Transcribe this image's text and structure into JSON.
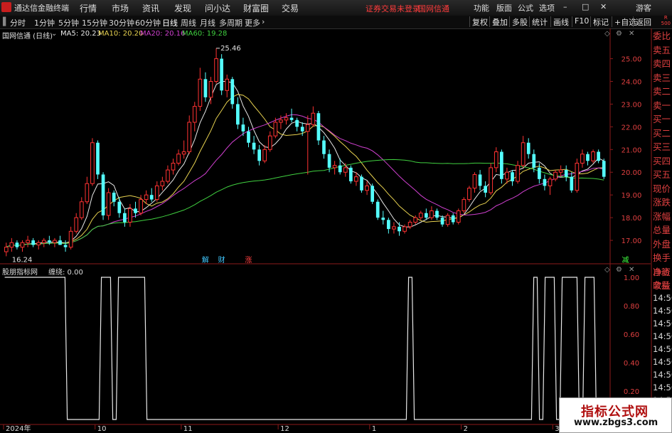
{
  "app_title": "通达信金融终端",
  "menu": [
    "行情",
    "市场",
    "资讯",
    "发现",
    "问小达",
    "财富圈",
    "交易"
  ],
  "notice": [
    "证券交易未登录",
    "国网信通"
  ],
  "right_menu": [
    "功能",
    "版面",
    "公式",
    "选项"
  ],
  "user": "游客",
  "timeframes": [
    "分时",
    "1分钟",
    "5分钟",
    "15分钟",
    "30分钟",
    "60分钟",
    "日线",
    "周线",
    "月线",
    "多周期",
    "更多"
  ],
  "active_timeframe": "日线",
  "right_buttons": [
    "复权",
    "叠加",
    "多股",
    "统计",
    "画线",
    "F10",
    "标记",
    "+自选",
    "返回"
  ],
  "r_badge": [
    "R",
    "500"
  ],
  "stock_label": "国网信通 (日线)",
  "ma": [
    {
      "label": "MA5: 20.23",
      "color": "#e8e8e8"
    },
    {
      "label": "MA10: 20.20",
      "color": "#e8d250"
    },
    {
      "label": "MA20: 20.16",
      "color": "#d040d0"
    },
    {
      "label": "MA60: 19.28",
      "color": "#40d040"
    }
  ],
  "order_panel": [
    "委比",
    "卖五",
    "卖四",
    "卖三",
    "卖二",
    "卖一",
    "买一",
    "买二",
    "买三",
    "买四",
    "买五",
    "现价",
    "涨跌",
    "涨幅",
    "总量",
    "外盘",
    "换手",
    "净资",
    "收益"
  ],
  "low_panel": [
    "自动",
    "交易",
    "14:56",
    "14:56",
    "14:56",
    "14:56",
    "14:56",
    "14:56",
    "14:56",
    "14:56",
    "14:56"
  ],
  "indicator_label": "股朋指标网",
  "indicator_value": "缠绕: 0.00",
  "markers": [
    {
      "text": "解",
      "color": "#40c8ff"
    },
    {
      "text": "财",
      "color": "#40c8ff"
    },
    {
      "text": "涨",
      "color": "#ff4040"
    },
    {
      "text": "减",
      "color": "#40ff40"
    }
  ],
  "watermark": [
    "指标公式网",
    "www.zbgs3.com"
  ],
  "chart_data": [
    {
      "type": "candlestick",
      "title": "国网信通 (日线)",
      "ylim": [
        16.0,
        25.8
      ],
      "yticks": [
        17.0,
        18.0,
        19.0,
        20.0,
        21.0,
        22.0,
        23.0,
        24.0,
        25.0
      ],
      "x_labels": [
        "2024年",
        "10",
        "11",
        "12",
        "1",
        "2",
        "3"
      ],
      "x_label_index": [
        0,
        17,
        33,
        51,
        68,
        85,
        102
      ],
      "annotations": [
        "25.46",
        "16.24"
      ],
      "candles": [
        {
          "o": 16.5,
          "h": 16.9,
          "l": 16.3,
          "c": 16.7
        },
        {
          "o": 16.7,
          "h": 17.1,
          "l": 16.5,
          "c": 16.9
        },
        {
          "o": 16.9,
          "h": 17.0,
          "l": 16.6,
          "c": 16.7
        },
        {
          "o": 16.7,
          "h": 17.0,
          "l": 16.5,
          "c": 16.9
        },
        {
          "o": 16.9,
          "h": 17.2,
          "l": 16.7,
          "c": 17.0
        },
        {
          "o": 17.0,
          "h": 17.1,
          "l": 16.7,
          "c": 16.8
        },
        {
          "o": 16.8,
          "h": 17.0,
          "l": 16.6,
          "c": 16.9
        },
        {
          "o": 16.9,
          "h": 17.1,
          "l": 16.7,
          "c": 17.0
        },
        {
          "o": 17.0,
          "h": 17.2,
          "l": 16.8,
          "c": 16.9
        },
        {
          "o": 16.9,
          "h": 17.1,
          "l": 16.7,
          "c": 17.0
        },
        {
          "o": 17.0,
          "h": 17.2,
          "l": 16.8,
          "c": 16.8
        },
        {
          "o": 16.8,
          "h": 17.0,
          "l": 16.5,
          "c": 16.7
        },
        {
          "o": 16.7,
          "h": 17.6,
          "l": 16.6,
          "c": 17.4
        },
        {
          "o": 17.4,
          "h": 18.2,
          "l": 17.3,
          "c": 18.0
        },
        {
          "o": 18.0,
          "h": 18.9,
          "l": 17.9,
          "c": 18.7
        },
        {
          "o": 18.7,
          "h": 19.8,
          "l": 18.6,
          "c": 19.5
        },
        {
          "o": 19.5,
          "h": 21.5,
          "l": 19.4,
          "c": 21.3
        },
        {
          "o": 21.3,
          "h": 21.4,
          "l": 19.7,
          "c": 19.9
        },
        {
          "o": 19.9,
          "h": 20.0,
          "l": 17.9,
          "c": 18.1
        },
        {
          "o": 18.1,
          "h": 19.3,
          "l": 17.9,
          "c": 19.1
        },
        {
          "o": 19.1,
          "h": 19.2,
          "l": 18.5,
          "c": 18.7
        },
        {
          "o": 18.7,
          "h": 18.9,
          "l": 18.0,
          "c": 18.2
        },
        {
          "o": 18.2,
          "h": 18.4,
          "l": 17.6,
          "c": 17.8
        },
        {
          "o": 17.8,
          "h": 18.6,
          "l": 17.6,
          "c": 18.4
        },
        {
          "o": 18.4,
          "h": 18.7,
          "l": 18.0,
          "c": 18.2
        },
        {
          "o": 18.2,
          "h": 19.0,
          "l": 18.1,
          "c": 18.8
        },
        {
          "o": 18.8,
          "h": 19.2,
          "l": 18.6,
          "c": 19.0
        },
        {
          "o": 19.0,
          "h": 19.3,
          "l": 18.7,
          "c": 18.8
        },
        {
          "o": 18.8,
          "h": 19.6,
          "l": 18.7,
          "c": 19.4
        },
        {
          "o": 19.4,
          "h": 19.8,
          "l": 19.2,
          "c": 19.6
        },
        {
          "o": 19.6,
          "h": 20.3,
          "l": 19.5,
          "c": 20.1
        },
        {
          "o": 20.1,
          "h": 20.6,
          "l": 19.9,
          "c": 20.4
        },
        {
          "o": 20.4,
          "h": 21.0,
          "l": 20.3,
          "c": 20.8
        },
        {
          "o": 20.8,
          "h": 21.4,
          "l": 20.6,
          "c": 20.9
        },
        {
          "o": 20.9,
          "h": 22.5,
          "l": 20.8,
          "c": 22.2
        },
        {
          "o": 22.2,
          "h": 23.1,
          "l": 21.8,
          "c": 22.9
        },
        {
          "o": 22.9,
          "h": 24.6,
          "l": 22.7,
          "c": 24.1
        },
        {
          "o": 24.1,
          "h": 24.4,
          "l": 23.1,
          "c": 23.3
        },
        {
          "o": 23.3,
          "h": 24.2,
          "l": 23.0,
          "c": 24.0
        },
        {
          "o": 24.0,
          "h": 25.46,
          "l": 23.9,
          "c": 25.0
        },
        {
          "o": 25.0,
          "h": 25.2,
          "l": 23.4,
          "c": 23.6
        },
        {
          "o": 23.6,
          "h": 24.3,
          "l": 23.3,
          "c": 24.1
        },
        {
          "o": 24.1,
          "h": 24.2,
          "l": 22.8,
          "c": 23.0
        },
        {
          "o": 23.0,
          "h": 23.3,
          "l": 21.9,
          "c": 22.1
        },
        {
          "o": 22.1,
          "h": 22.4,
          "l": 21.6,
          "c": 21.8
        },
        {
          "o": 21.8,
          "h": 22.0,
          "l": 21.1,
          "c": 21.3
        },
        {
          "o": 21.3,
          "h": 21.6,
          "l": 20.8,
          "c": 21.0
        },
        {
          "o": 21.0,
          "h": 21.2,
          "l": 20.3,
          "c": 20.5
        },
        {
          "o": 20.5,
          "h": 21.2,
          "l": 20.4,
          "c": 21.0
        },
        {
          "o": 21.0,
          "h": 21.8,
          "l": 20.9,
          "c": 21.6
        },
        {
          "o": 21.6,
          "h": 22.4,
          "l": 21.5,
          "c": 22.2
        },
        {
          "o": 22.2,
          "h": 22.5,
          "l": 21.9,
          "c": 22.3
        },
        {
          "o": 22.3,
          "h": 22.6,
          "l": 22.1,
          "c": 22.4
        },
        {
          "o": 22.4,
          "h": 22.8,
          "l": 22.2,
          "c": 22.3
        },
        {
          "o": 22.3,
          "h": 22.4,
          "l": 21.8,
          "c": 22.0
        },
        {
          "o": 22.0,
          "h": 22.2,
          "l": 21.6,
          "c": 21.8
        },
        {
          "o": 21.8,
          "h": 22.5,
          "l": 19.9,
          "c": 22.1
        },
        {
          "o": 22.1,
          "h": 22.9,
          "l": 22.0,
          "c": 22.6
        },
        {
          "o": 22.6,
          "h": 22.7,
          "l": 21.2,
          "c": 21.4
        },
        {
          "o": 21.4,
          "h": 21.6,
          "l": 20.6,
          "c": 20.8
        },
        {
          "o": 20.8,
          "h": 21.0,
          "l": 20.0,
          "c": 20.2
        },
        {
          "o": 20.2,
          "h": 20.5,
          "l": 19.9,
          "c": 20.3
        },
        {
          "o": 20.3,
          "h": 20.6,
          "l": 19.9,
          "c": 20.0
        },
        {
          "o": 20.0,
          "h": 20.4,
          "l": 19.8,
          "c": 20.2
        },
        {
          "o": 20.2,
          "h": 20.3,
          "l": 19.5,
          "c": 19.6
        },
        {
          "o": 19.6,
          "h": 20.0,
          "l": 19.4,
          "c": 19.8
        },
        {
          "o": 19.8,
          "h": 19.9,
          "l": 19.1,
          "c": 19.2
        },
        {
          "o": 19.2,
          "h": 19.6,
          "l": 19.0,
          "c": 19.4
        },
        {
          "o": 19.4,
          "h": 19.5,
          "l": 18.6,
          "c": 18.7
        },
        {
          "o": 18.7,
          "h": 18.8,
          "l": 17.9,
          "c": 18.0
        },
        {
          "o": 18.0,
          "h": 18.3,
          "l": 17.7,
          "c": 17.9
        },
        {
          "o": 17.9,
          "h": 18.0,
          "l": 17.3,
          "c": 17.5
        },
        {
          "o": 17.5,
          "h": 17.8,
          "l": 17.3,
          "c": 17.6
        },
        {
          "o": 17.6,
          "h": 17.8,
          "l": 17.2,
          "c": 17.4
        },
        {
          "o": 17.4,
          "h": 17.7,
          "l": 17.3,
          "c": 17.6
        },
        {
          "o": 17.6,
          "h": 17.9,
          "l": 17.5,
          "c": 17.8
        },
        {
          "o": 17.8,
          "h": 18.1,
          "l": 17.7,
          "c": 18.0
        },
        {
          "o": 18.0,
          "h": 18.3,
          "l": 17.9,
          "c": 18.2
        },
        {
          "o": 18.2,
          "h": 18.4,
          "l": 17.9,
          "c": 18.0
        },
        {
          "o": 18.0,
          "h": 18.5,
          "l": 17.9,
          "c": 18.3
        },
        {
          "o": 18.3,
          "h": 18.4,
          "l": 17.9,
          "c": 18.0
        },
        {
          "o": 18.0,
          "h": 18.1,
          "l": 17.6,
          "c": 17.7
        },
        {
          "o": 17.7,
          "h": 18.2,
          "l": 17.6,
          "c": 18.1
        },
        {
          "o": 18.1,
          "h": 18.2,
          "l": 17.7,
          "c": 17.8
        },
        {
          "o": 17.8,
          "h": 18.4,
          "l": 17.7,
          "c": 18.3
        },
        {
          "o": 18.3,
          "h": 18.9,
          "l": 18.2,
          "c": 18.8
        },
        {
          "o": 18.8,
          "h": 19.4,
          "l": 18.7,
          "c": 19.3
        },
        {
          "o": 19.3,
          "h": 20.0,
          "l": 19.1,
          "c": 19.9
        },
        {
          "o": 19.9,
          "h": 20.1,
          "l": 19.2,
          "c": 19.4
        },
        {
          "o": 19.4,
          "h": 19.6,
          "l": 18.9,
          "c": 19.1
        },
        {
          "o": 19.1,
          "h": 20.4,
          "l": 19.0,
          "c": 20.2
        },
        {
          "o": 20.2,
          "h": 21.1,
          "l": 20.0,
          "c": 20.9
        },
        {
          "o": 20.9,
          "h": 21.0,
          "l": 19.5,
          "c": 19.7
        },
        {
          "o": 19.7,
          "h": 20.2,
          "l": 19.5,
          "c": 20.0
        },
        {
          "o": 20.0,
          "h": 20.1,
          "l": 19.4,
          "c": 19.6
        },
        {
          "o": 19.6,
          "h": 20.5,
          "l": 19.5,
          "c": 20.3
        },
        {
          "o": 20.3,
          "h": 21.6,
          "l": 20.2,
          "c": 21.3
        },
        {
          "o": 21.3,
          "h": 21.5,
          "l": 20.6,
          "c": 20.8
        },
        {
          "o": 20.8,
          "h": 21.0,
          "l": 20.0,
          "c": 20.2
        },
        {
          "o": 20.2,
          "h": 20.4,
          "l": 19.5,
          "c": 19.7
        },
        {
          "o": 19.7,
          "h": 19.9,
          "l": 19.2,
          "c": 19.4
        },
        {
          "o": 19.4,
          "h": 19.8,
          "l": 19.0,
          "c": 19.7
        },
        {
          "o": 19.7,
          "h": 20.1,
          "l": 19.6,
          "c": 20.0
        },
        {
          "o": 20.0,
          "h": 20.3,
          "l": 19.8,
          "c": 20.1
        },
        {
          "o": 20.1,
          "h": 20.3,
          "l": 19.6,
          "c": 19.8
        },
        {
          "o": 19.8,
          "h": 20.0,
          "l": 19.1,
          "c": 19.2
        },
        {
          "o": 19.2,
          "h": 20.6,
          "l": 19.1,
          "c": 20.4
        },
        {
          "o": 20.4,
          "h": 21.0,
          "l": 20.2,
          "c": 20.8
        },
        {
          "o": 20.8,
          "h": 20.9,
          "l": 20.3,
          "c": 20.5
        },
        {
          "o": 20.5,
          "h": 21.0,
          "l": 20.4,
          "c": 20.9
        },
        {
          "o": 20.9,
          "h": 21.0,
          "l": 20.4,
          "c": 20.5
        },
        {
          "o": 20.5,
          "h": 20.6,
          "l": 19.7,
          "c": 19.8
        }
      ]
    },
    {
      "type": "line",
      "title": "缠绕",
      "ylim": [
        0,
        1.0
      ],
      "yticks": [
        0.2,
        0.4,
        0.6,
        0.8,
        1.0
      ],
      "values": [
        1,
        1,
        1,
        1,
        1,
        1,
        1,
        1,
        1,
        1,
        1,
        0,
        0,
        0,
        0,
        0,
        0,
        1,
        1,
        0,
        1,
        1,
        1,
        1,
        1,
        0,
        0,
        0,
        0,
        0,
        0,
        0,
        0,
        0,
        0,
        0,
        0,
        0,
        0,
        0,
        0,
        0,
        0,
        0,
        0,
        0,
        0,
        0,
        0,
        0,
        0,
        0,
        0,
        0,
        0,
        0,
        0,
        0,
        0,
        0,
        0,
        0,
        0,
        0,
        0,
        0,
        0,
        0,
        0,
        0,
        0,
        1,
        0,
        0,
        0,
        0,
        0,
        0,
        0,
        0,
        0,
        0,
        0,
        0,
        0,
        0,
        0,
        0,
        0,
        0,
        0,
        0,
        0,
        1,
        0,
        1,
        1,
        0,
        1,
        1,
        1,
        0,
        1,
        1,
        0,
        0
      ]
    }
  ]
}
